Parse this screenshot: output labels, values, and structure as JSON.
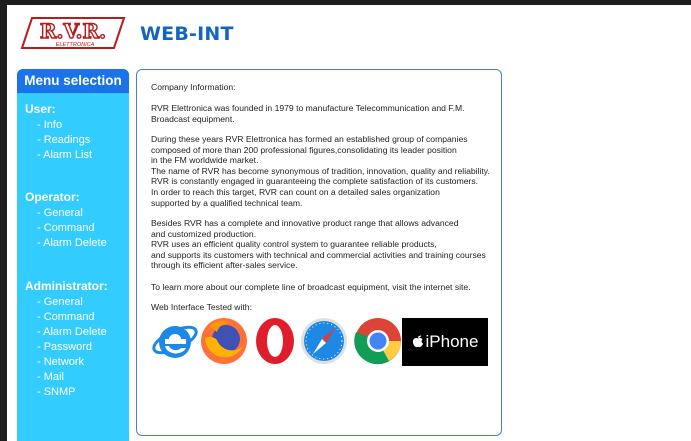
{
  "header": {
    "logo_text": "R.V.R.",
    "logo_subtext": "ELETTRONICA",
    "title": "WEB-INT"
  },
  "sidebar": {
    "title": "Menu selection",
    "sections": [
      {
        "label": "User:",
        "items": [
          "- Info",
          "- Readings",
          "- Alarm List"
        ]
      },
      {
        "label": "Operator:",
        "items": [
          "- General",
          "- Command",
          "- Alarm Delete"
        ]
      },
      {
        "label": "Administrator:",
        "items": [
          "- General",
          "- Command",
          "- Alarm Delete",
          "- Password",
          "- Network",
          "- Mail",
          "- SNMP"
        ]
      }
    ]
  },
  "content": {
    "paragraphs": [
      "Company Information:",
      "RVR Elettronica was founded in 1979 to manufacture Telecommunication and F.M.\nBroadcast equipment.",
      "During these years RVR Elettronica has formed an established group of companies\ncomposed of more than 200 professional figures,consolidating its leader position\nin the FM worldwide market.\nThe name of RVR has become synonymous of tradition, innovation, quality and reliability.\nRVR is constantly engaged in guaranteeing the complete satisfaction of its customers.\nIn order to reach this target, RVR can count on a detailed sales organization\nsupported by a qualified technical team.",
      "Besides RVR has a complete and innovative product range that allows advanced\nand customized production.\nRVR uses an efficient quality control system to guarantee reliable products,\nand supports its customers with technical and commercial activities and training courses\nthrough its efficient after-sales service.",
      "To learn more about our complete line of broadcast equipment, visit the internet site.",
      "Web Interface Tested with:"
    ],
    "browsers": [
      "ie-icon",
      "firefox-icon",
      "opera-icon",
      "safari-icon",
      "chrome-icon",
      "iphone-logo"
    ],
    "iphone_label": "iPhone"
  },
  "colors": {
    "sidebar_bg": "#33ccff",
    "menu_title_bg": "#1a73e8",
    "title_blue": "#1565c0",
    "logo_red": "#b71c1c",
    "content_border": "#4a7fd6"
  }
}
